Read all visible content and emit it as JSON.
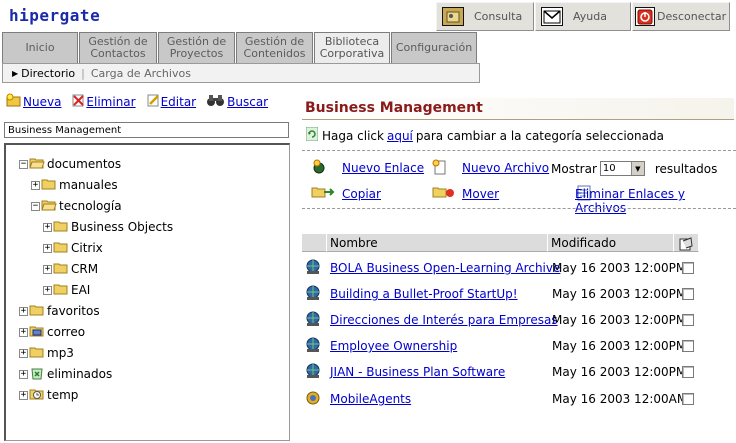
{
  "app": {
    "logo": "hipergate"
  },
  "top_buttons": [
    {
      "label": "Consulta"
    },
    {
      "label": "Ayuda"
    },
    {
      "label": "Desconectar"
    }
  ],
  "tabs": [
    {
      "label": "Inicio"
    },
    {
      "label": "Gestión de Contactos"
    },
    {
      "label": "Gestión de Proyectos"
    },
    {
      "label": "Gestión de Contenidos"
    },
    {
      "label": "Biblioteca Corporativa"
    },
    {
      "label": "Configuración"
    }
  ],
  "subnav": {
    "current": "Directorio",
    "other": "Carga de Archivos"
  },
  "left_actions": [
    {
      "label": "Nueva"
    },
    {
      "label": "Eliminar"
    },
    {
      "label": "Editar"
    },
    {
      "label": "Buscar"
    }
  ],
  "category_value": "Business Management",
  "tree": [
    {
      "label": "documentos",
      "sign": "−"
    },
    {
      "label": "manuales",
      "sign": "+"
    },
    {
      "label": "tecnología",
      "sign": "−"
    },
    {
      "label": "Business Objects",
      "sign": "+"
    },
    {
      "label": "Citrix",
      "sign": "+"
    },
    {
      "label": "CRM",
      "sign": "+"
    },
    {
      "label": "EAI",
      "sign": "+"
    },
    {
      "label": "favoritos",
      "sign": "+"
    },
    {
      "label": "correo",
      "sign": "+"
    },
    {
      "label": "mp3",
      "sign": "+"
    },
    {
      "label": "eliminados",
      "sign": "+"
    },
    {
      "label": "temp",
      "sign": "+"
    }
  ],
  "right": {
    "title": "Business Management",
    "click_prefix": "Haga click",
    "click_link": "aquí",
    "click_suffix": "para cambiar a la categoría seleccionada",
    "ops": {
      "new_link": "Nuevo Enlace",
      "new_file": "Nuevo Archivo",
      "copy": "Copiar",
      "move": "Mover",
      "delete": "Eliminar Enlaces y Archivos"
    },
    "mostrar": {
      "label": "Mostrar",
      "value": "10",
      "suffix": "resultados"
    },
    "columns": {
      "name": "Nombre",
      "modified": "Modificado"
    },
    "rows": [
      {
        "name": "BOLA Business Open-Learning Archive",
        "date": "May 16 2003 12:00PM"
      },
      {
        "name": "Building a Bullet-Proof StartUp!",
        "date": "May 16 2003 12:00PM"
      },
      {
        "name": "Direcciones de Interés para Empresas",
        "date": "May 16 2003 12:00PM"
      },
      {
        "name": "Employee Ownership",
        "date": "May 16 2003 12:00PM"
      },
      {
        "name": "JIAN - Business Plan Software",
        "date": "May 16 2003 12:00PM"
      },
      {
        "name": "MobileAgents",
        "date": "May 16 2003 12:00AM"
      }
    ]
  }
}
